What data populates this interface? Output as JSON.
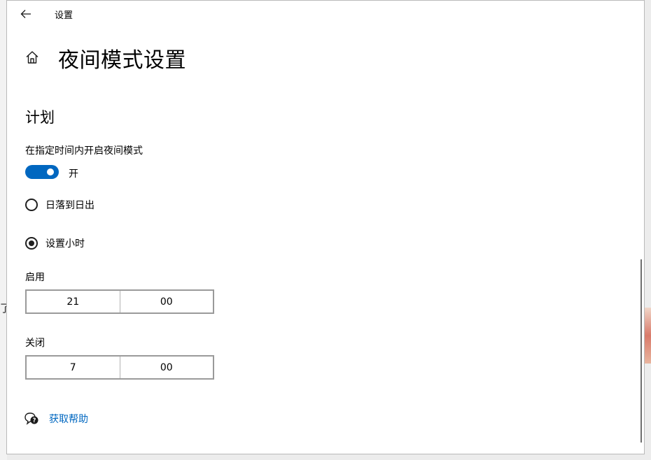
{
  "background": {
    "fragment_text": "了"
  },
  "window": {
    "title": "设置",
    "back_icon": "arrow-left-icon"
  },
  "page": {
    "home_icon": "home-icon",
    "title": "夜间模式设置"
  },
  "schedule": {
    "section_title": "计划",
    "toggle_label": "在指定时间内开启夜间模式",
    "toggle_on": true,
    "toggle_state_text": "开",
    "options": [
      {
        "label": "日落到日出",
        "selected": false
      },
      {
        "label": "设置小时",
        "selected": true
      }
    ],
    "turn_on": {
      "label": "启用",
      "hour": "21",
      "minute": "00"
    },
    "turn_off": {
      "label": "关闭",
      "hour": "7",
      "minute": "00"
    }
  },
  "help": {
    "icon": "help-chat-icon",
    "link_text": "获取帮助"
  },
  "colors": {
    "accent": "#0067c0",
    "window_bg": "#ffffff",
    "desktop_bg": "#ececec"
  }
}
